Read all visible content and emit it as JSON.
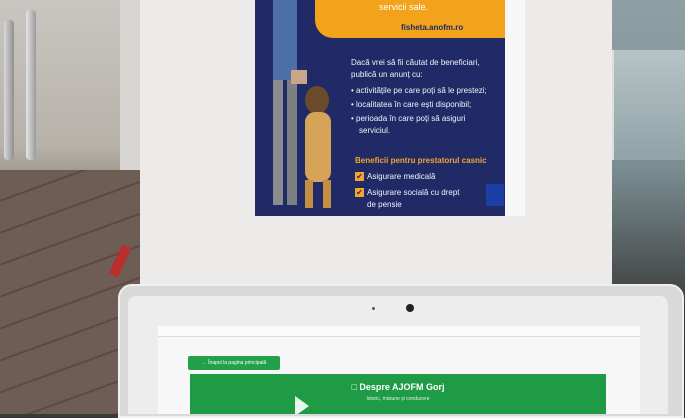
{
  "poster": {
    "top_text": "servicii sale.",
    "top_link": "fisheta.anofm.ro",
    "intro": [
      "Dacă vrei să fii căutat de beneficiari,",
      "publică un anunț cu:"
    ],
    "bullets": [
      "activitățile pe care poți să le prestezi;",
      "localitatea în care ești disponibil;",
      "perioada în care poți să asiguri",
      "serviciul."
    ],
    "benefits_title": "Beneficii pentru prestatorul casnic",
    "benefits": [
      "Asigurare medicală",
      "Asigurare socială cu drept",
      "de pensie"
    ]
  },
  "laptop_screen": {
    "back_button": "← Înapoi la pagina principală",
    "title": "□ Despre AJOFM Gorj",
    "subtitle": "Istoric, misiune și conducere"
  },
  "colors": {
    "poster_navy": "#1f2a66",
    "poster_orange": "#f2a21b",
    "screen_green": "#1f9b45"
  }
}
